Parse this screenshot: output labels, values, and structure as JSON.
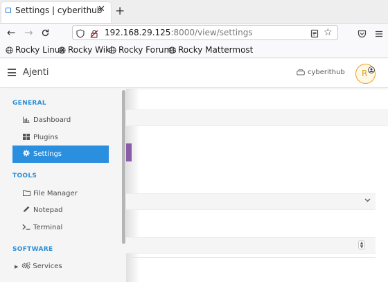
{
  "browser": {
    "tab_title": "Settings | cyberithub",
    "tab_close": "✕",
    "new_tab": "+",
    "url_host": "192.168.29.125",
    "url_rest": ":8000/view/settings",
    "bookmarks": [
      "Rocky Linux",
      "Rocky Wiki",
      "Rocky Forums",
      "Rocky Mattermost"
    ]
  },
  "app": {
    "name": "Ajenti",
    "user": "cyberithub",
    "avatar_letter": "R"
  },
  "sidebar": {
    "sections": [
      {
        "title": "GENERAL"
      },
      {
        "title": "TOOLS"
      },
      {
        "title": "SOFTWARE"
      }
    ],
    "items": [
      {
        "label": "Dashboard",
        "icon": "chart-icon"
      },
      {
        "label": "Plugins",
        "icon": "grid-icon"
      },
      {
        "label": "Settings",
        "icon": "gear-icon",
        "active": true
      },
      {
        "label": "File Manager",
        "icon": "folder-icon"
      },
      {
        "label": "Notepad",
        "icon": "pencil-icon"
      },
      {
        "label": "Terminal",
        "icon": "terminal-icon"
      },
      {
        "label": "Services",
        "icon": "gears-icon"
      }
    ]
  },
  "colors": {
    "accent": "#2b8fe0",
    "section": "#2b8fd6",
    "avatar_ring": "#f0a020"
  }
}
